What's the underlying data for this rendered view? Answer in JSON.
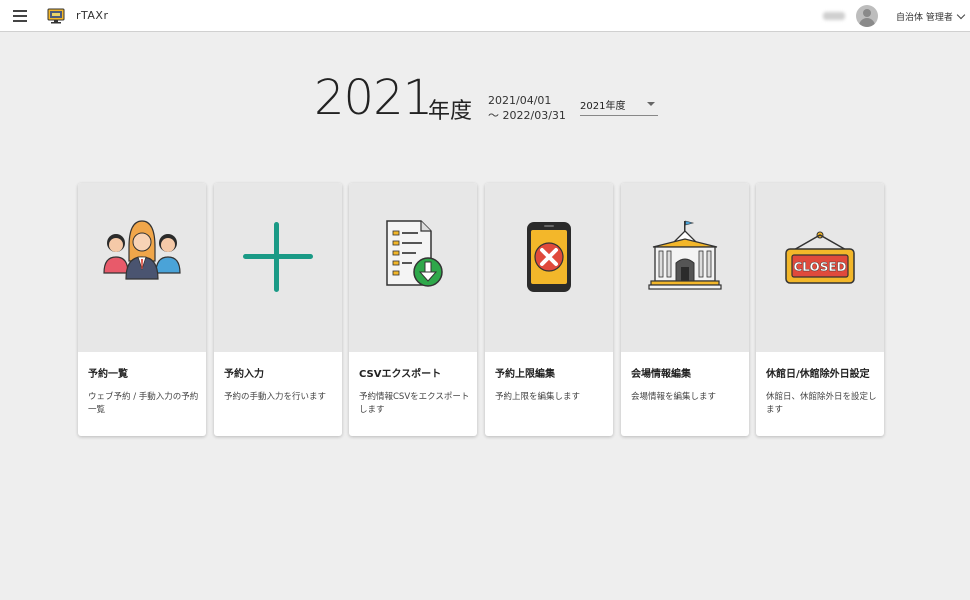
{
  "header": {
    "app_name": "rTAXr",
    "user_name": "自治体 管理者",
    "icons": {
      "menu": "hamburger-menu-icon",
      "logo": "app-logo-icon",
      "avatar": "user-avatar-icon",
      "dropdown": "chevron-down-icon"
    }
  },
  "fiscal_year": {
    "year": "2021",
    "suffix": "年度",
    "start_date": "2021/04/01",
    "end_date": "～ 2022/03/31",
    "selector_value": "2021年度"
  },
  "cards": [
    {
      "title": "予約一覧",
      "description": "ウェブ予約 / 手動入力の予約一覧",
      "icon": "people-group-icon"
    },
    {
      "title": "予約入力",
      "description": "予約の手動入力を行います",
      "icon": "plus-icon"
    },
    {
      "title": "CSVエクスポート",
      "description": "予約情報CSVをエクスポートします",
      "icon": "document-download-icon"
    },
    {
      "title": "予約上限編集",
      "description": "予約上限を編集します",
      "icon": "phone-cancel-icon"
    },
    {
      "title": "会場情報編集",
      "description": "会場情報を編集します",
      "icon": "building-icon"
    },
    {
      "title": "休館日/休館除外日設定",
      "description": "休館日、休館除外日を設定します",
      "icon": "closed-sign-icon",
      "sign_text": "CLOSED"
    }
  ],
  "colors": {
    "accent_teal": "#1a9a86",
    "sign_red": "#e04a3c",
    "card_thumb_bg": "#e7e7e7",
    "page_bg": "#eeeeee"
  }
}
